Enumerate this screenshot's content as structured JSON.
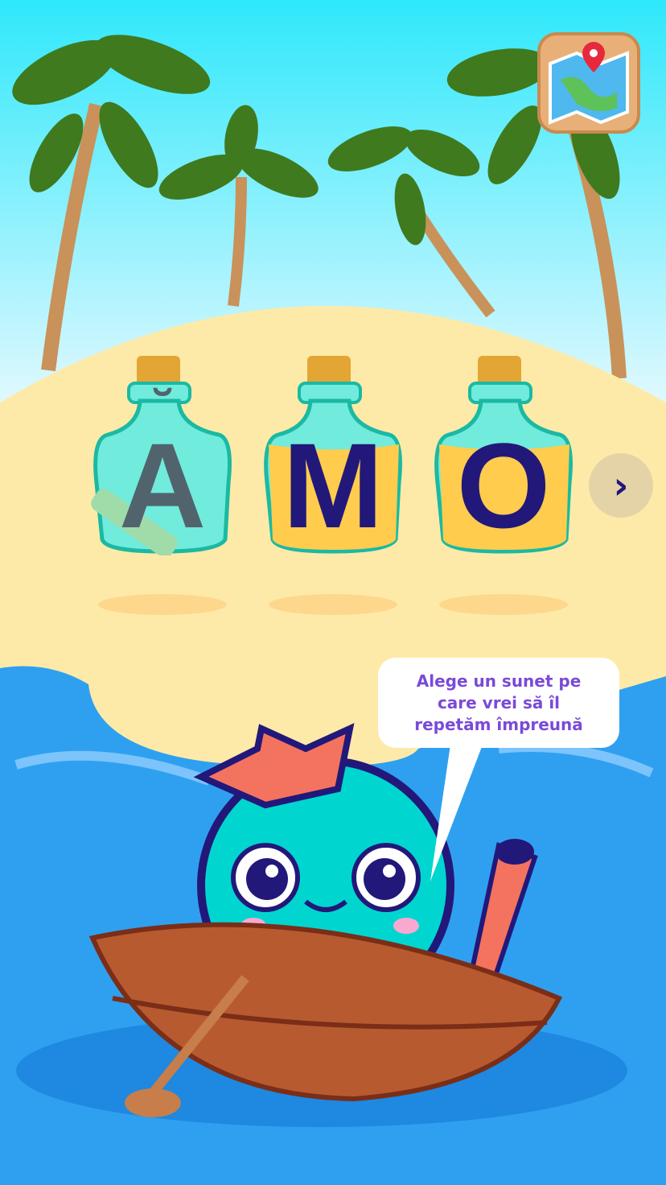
{
  "bottles": [
    {
      "letter": "A",
      "breve": "˘",
      "style": "empty",
      "letter_color": "#51646e"
    },
    {
      "letter": "M",
      "style": "filled",
      "letter_color": "#22187a"
    },
    {
      "letter": "O",
      "style": "filled",
      "letter_color": "#22187a"
    }
  ],
  "next_button": {
    "icon": "chevron-right-icon",
    "symbol": "›"
  },
  "map_button": {
    "icon": "map-icon"
  },
  "speech_bubble": {
    "lines": [
      "Alege un sunet pe",
      "care vrei să îl",
      "repetăm împreună"
    ]
  },
  "colors": {
    "sky_top": "#2ee8fb",
    "sky_bottom": "#e8f9ff",
    "sand": "#feeaa8",
    "sea": "#2fa0f0",
    "bubble_text": "#7a4ad8"
  }
}
